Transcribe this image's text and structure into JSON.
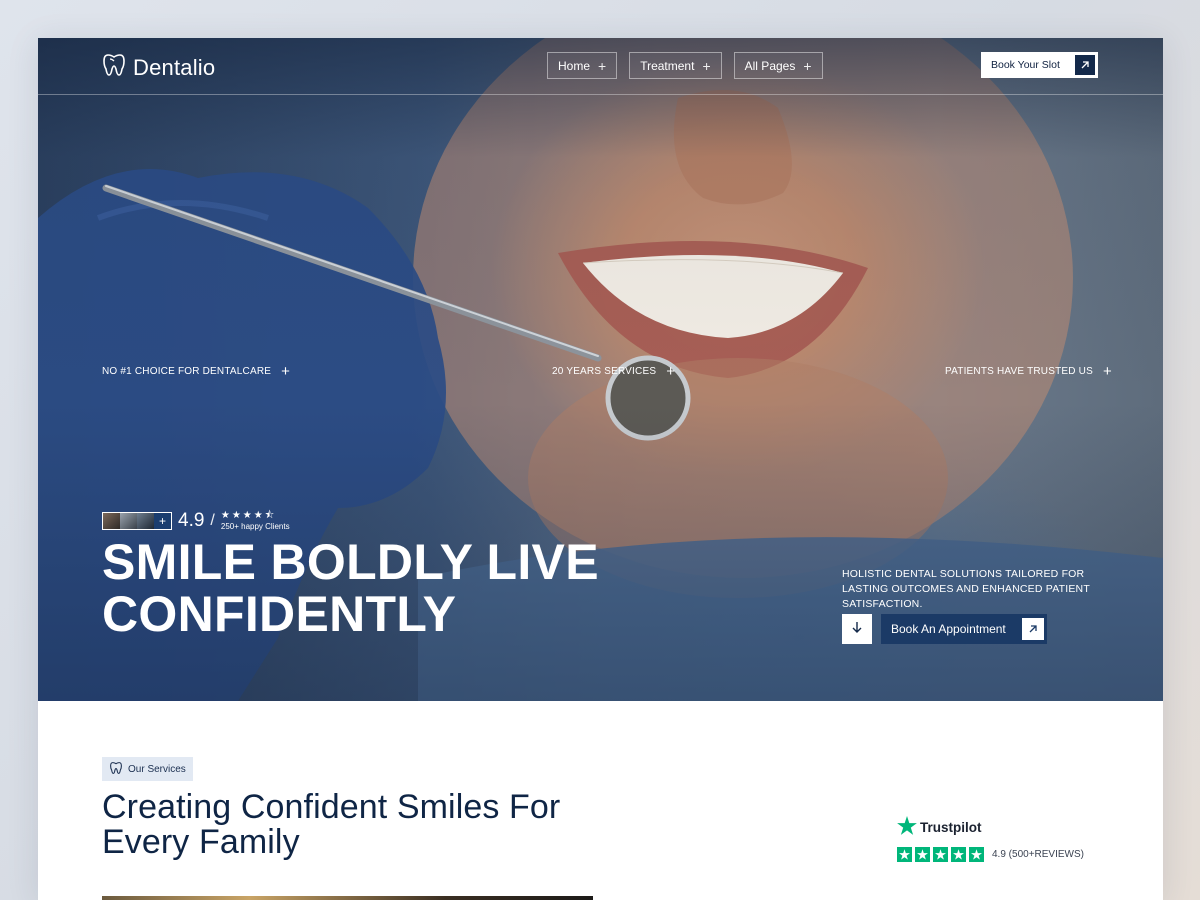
{
  "brand": {
    "name": "Dentalio"
  },
  "nav": {
    "items": [
      {
        "label": "Home"
      },
      {
        "label": "Treatment"
      },
      {
        "label": "All Pages"
      }
    ],
    "cta_label": "Book Your Slot"
  },
  "hero": {
    "features": [
      {
        "label": "NO #1 CHOICE FOR DENTALCARE"
      },
      {
        "label": "20 YEARS SERVICES"
      },
      {
        "label": "PATIENTS HAVE TRUSTED US"
      }
    ],
    "rating": {
      "score": "4.9",
      "stars": "★★★★⯪",
      "clients": "250+ happy Clients"
    },
    "headline_line1": "SMILE BOLDLY LIVE",
    "headline_line2": "CONFIDENTLY",
    "description": "HOLISTIC DENTAL SOLUTIONS TAILORED FOR LASTING OUTCOMES AND ENHANCED PATIENT SATISFACTION.",
    "appointment_label": "Book An Appointment"
  },
  "services": {
    "badge": "Our Services",
    "title_line1": "Creating Confident Smiles For",
    "title_line2": "Every Family"
  },
  "trustpilot": {
    "brand": "Trustpilot",
    "rating_text": "4.9 (500+REVIEWS)",
    "rating_value": 5
  },
  "colors": {
    "navy": "#13294a",
    "appointment_blue": "#1b3a66",
    "trustpilot_green": "#00b67a",
    "title_navy": "#0f2545"
  },
  "icons": [
    "tooth-logo-icon",
    "plus-icon",
    "arrow-up-right-icon",
    "arrow-down-icon",
    "star-icon"
  ]
}
